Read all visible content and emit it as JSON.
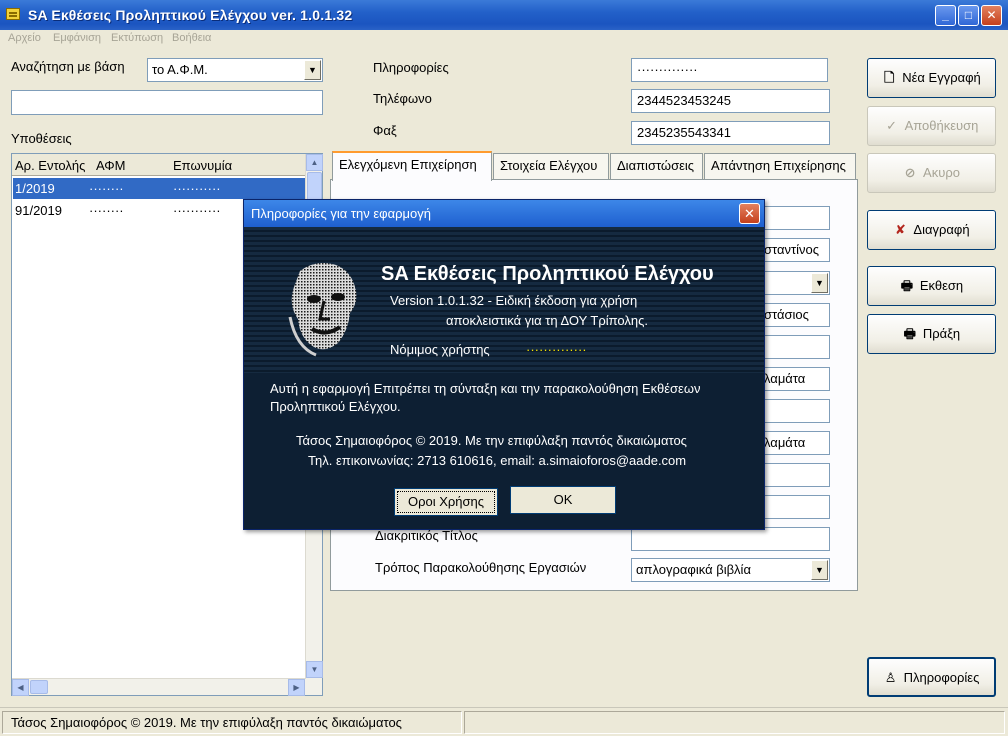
{
  "window": {
    "title": "SA Εκθέσεις Προληπτικού Ελέγχου ver. 1.0.1.32"
  },
  "menu": [
    "Αρχείο",
    "Εμφάνιση",
    "Εκτύπωση",
    "Βοήθεια"
  ],
  "search": {
    "label": "Αναζήτηση με βάση",
    "mode": "το Α.Φ.Μ.",
    "value": ""
  },
  "cases": {
    "label": "Υποθέσεις",
    "columns": [
      "Αρ. Εντολής",
      "ΑΦΜ",
      "Επωνυμία"
    ],
    "rows": [
      {
        "order": "1/2019",
        "afm": "········",
        "name": "···········"
      },
      {
        "order": "91/2019",
        "afm": "········",
        "name": "···········"
      }
    ]
  },
  "info": {
    "label": "Πληροφορίες",
    "value": "··············",
    "phone_label": "Τηλέφωνο",
    "phone": "2344523453245",
    "fax_label": "Φαξ",
    "fax": "2345235543341"
  },
  "tabs": [
    "Ελεγχόμενη Επιχείρηση",
    "Στοιχεία Ελέγχου",
    "Διαπιστώσεις",
    "Απάντηση Επιχείρησης"
  ],
  "form": {
    "partial_values": [
      "σταντίνος",
      "στάσιος",
      "λαμάτα",
      "λαμάτα"
    ],
    "title_label": "Διακριτικός Τίτλος",
    "tracking_label": "Τρόπος Παρακολούθησης Εργασιών",
    "tracking_value": "απλογραφικά βιβλία"
  },
  "buttons": {
    "new": "Νέα Εγγραφή",
    "save": "Αποθήκευση",
    "cancel": "Ακυρο",
    "delete": "Διαγραφή",
    "report": "Εκθεση",
    "act": "Πράξη",
    "info": "Πληροφορίες"
  },
  "status": {
    "text": "Τάσος Σημαιοφόρος © 2019. Με την επιφύλαξη παντός δικαιώματος"
  },
  "dialog": {
    "title": "Πληροφορίες για την εφαρμογή",
    "heading": "SA Εκθέσεις Προληπτικού Ελέγχου",
    "version_line1": "Version  1.0.1.32 - Ειδική έκδοση για χρήση",
    "version_line2": "αποκλειστικά για τη ΔΟΥ Τρίπολης.",
    "user_label": "Νόμιμος χρήστης",
    "user_value": "··············",
    "desc_line1": "Αυτή η εφαρμογή Επιτρέπει τη σύνταξη και την παρακολούθηση Εκθέσεων",
    "desc_line2": "Προληπτικού Ελέγχου.",
    "copyright": "Τάσος Σημαιοφόρος © 2019. Με την επιφύλαξη παντός δικαιώματος",
    "contact": "Τηλ. επικοινωνίας: 2713 610616, email: a.simaioforos@aade.com",
    "terms_button": "Οροι Χρήσης",
    "ok_button": "OK"
  },
  "colors": {
    "titlebar": "#2361c9",
    "selection": "#316ac5",
    "dialog_bg": "#0e2034",
    "user_value": "#f7e400"
  }
}
